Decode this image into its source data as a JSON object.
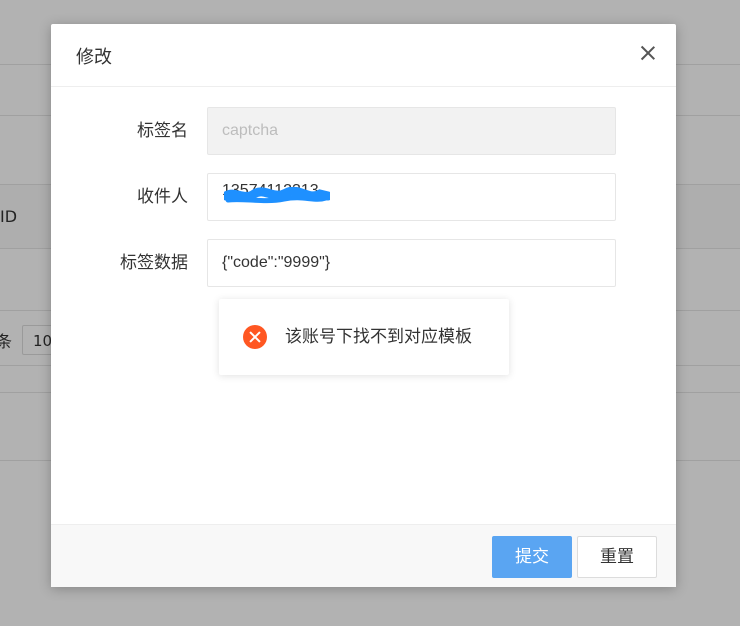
{
  "background": {
    "id_fragment": "ID",
    "tiao_fragment": "条",
    "select_value": "10"
  },
  "dialog": {
    "title": "修改",
    "close_icon": "close-icon",
    "fields": [
      {
        "label": "标签名",
        "value": "captcha",
        "disabled": true
      },
      {
        "label": "收件人",
        "value": "13574112313",
        "redacted": true
      },
      {
        "label": "标签数据",
        "value": "{\"code\":\"9999\"}"
      }
    ],
    "toast": {
      "icon": "error-circle-icon",
      "message": "该账号下找不到对应模板",
      "color": "#ff5722"
    },
    "buttons": {
      "submit": "提交",
      "reset": "重置"
    },
    "colors": {
      "primary": "#5aa5f2",
      "redaction": "#1e90ff"
    }
  }
}
